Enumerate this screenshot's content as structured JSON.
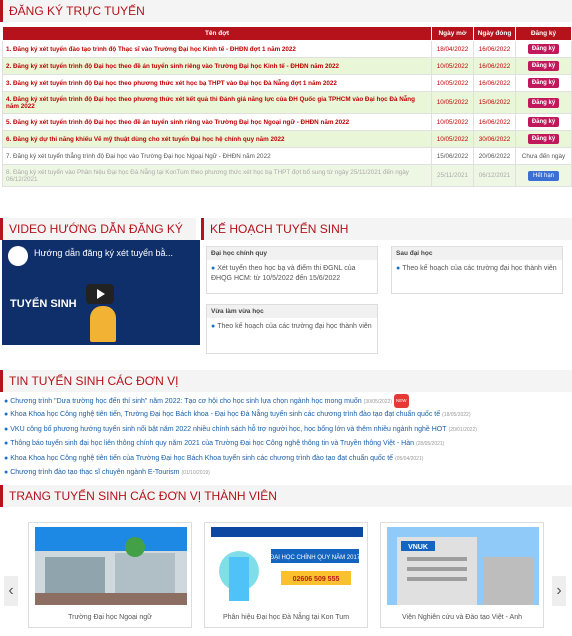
{
  "registration": {
    "title": "ĐĂNG KÝ TRỰC TUYẾN",
    "columns": [
      "Tên đợt",
      "Ngày mở",
      "Ngày đóng",
      "Đăng ký"
    ],
    "rows": [
      {
        "name": "1. Đăng ký xét tuyển đào tạo trình độ Thạc sĩ vào Trường Đại học Kinh tế - ĐHĐN đợt 1 năm 2022",
        "open": "18/04/2022",
        "close": "16/06/2022",
        "action": "Đăng ký",
        "state": "open"
      },
      {
        "name": "2. Đăng ký xét tuyển trình độ Đại học theo đề án tuyển sinh riêng vào Trường Đại học Kinh tế - ĐHĐN năm 2022",
        "open": "10/05/2022",
        "close": "16/06/2022",
        "action": "Đăng ký",
        "state": "open"
      },
      {
        "name": "3. Đăng ký xét tuyển trình độ Đại học theo phương thức xét học bạ THPT vào Đại học Đà Nẵng đợt 1 năm 2022",
        "open": "10/05/2022",
        "close": "16/06/2022",
        "action": "Đăng ký",
        "state": "open"
      },
      {
        "name": "4. Đăng ký xét tuyển trình độ Đại học theo phương thức xét kết quả thi Đánh giá năng lực của ĐH Quốc gia TPHCM vào Đại học Đà Nẵng năm 2022",
        "open": "10/05/2022",
        "close": "15/06/2022",
        "action": "Đăng ký",
        "state": "open"
      },
      {
        "name": "5. Đăng ký xét tuyển trình độ Đại học theo đề án tuyển sinh riêng vào Trường Đại học Ngoại ngữ - ĐHĐN năm 2022",
        "open": "10/05/2022",
        "close": "16/06/2022",
        "action": "Đăng ký",
        "state": "open"
      },
      {
        "name": "6. Đăng ký dự thi năng khiếu Vẽ mỹ thuật dùng cho xét tuyển Đại học hệ chính quy năm 2022",
        "open": "10/05/2022",
        "close": "30/06/2022",
        "action": "Đăng ký",
        "state": "open"
      },
      {
        "name": "7. Đăng ký xét tuyển thẳng trình độ Đại học vào Trường Đại học Ngoại Ngữ - ĐHĐN năm 2022",
        "open": "15/06/2022",
        "close": "20/06/2022",
        "action": "Chưa đến ngày",
        "state": "closed"
      },
      {
        "name": "8. Đăng ký xét tuyển vào Phân hiệu Đại học Đà Nẵng tại KonTum theo phương thức xét học bạ THPT đợt bổ sung từ ngày 25/11/2021 đến ngày 06/12/2021",
        "open": "25/11/2021",
        "close": "06/12/2021",
        "action": "Hết hạn",
        "state": "future"
      }
    ]
  },
  "video": {
    "title": "VIDEO HƯỚNG DẪN ĐĂNG KÝ",
    "caption": "Hướng dẫn đăng ký xét tuyển bằ...",
    "banner": "TUYỂN SINH"
  },
  "plan": {
    "title": "KẾ HOẠCH TUYỂN SINH",
    "boxes": [
      {
        "head": "Đại học chính quy",
        "body": "Xét tuyển theo học bạ và điểm thi ĐGNL của ĐHQG HCM: từ 10/5/2022 đến 15/6/2022"
      },
      {
        "head": "Sau đại học",
        "body": "Theo kế hoạch của các trường đại học thành viên"
      },
      {
        "head": "Vừa làm vừa học",
        "body": "Theo kế hoạch của các trường đại học thành viên"
      }
    ]
  },
  "news": {
    "title": "TIN TUYỂN SINH CÁC ĐƠN VỊ",
    "badge_new": "NEW",
    "items": [
      {
        "text": "Chương trình \"Dưa trường học đến thí sinh\" năm 2022: Tạo cơ hội cho học sinh lựa chọn ngành học mong muốn",
        "date": "(30/05/2022)",
        "new": true
      },
      {
        "text": "Khoa Khoa học Công nghệ tiên tiến, Trường Đại học Bách khoa - Đại học Đà Nẵng tuyển sinh các chương trình đào tạo đạt chuẩn quốc tế",
        "date": "(18/05/2022)",
        "new": false
      },
      {
        "text": "VKU công bố phương hướng tuyển sinh nổi bật năm 2022 nhiều chính sách hỗ trợ người học, học bổng lớn và thêm nhiều ngành nghề HOT",
        "date": "(20/01/2022)",
        "new": false
      },
      {
        "text": "Thông báo tuyển sinh đại học liên thông chính quy năm 2021 của Trường Đại học Công nghệ thông tin và Truyền thông Việt - Hàn",
        "date": "(28/05/2021)",
        "new": false
      },
      {
        "text": "Khoa Khoa học Công nghệ tiên tiến của Trường Đại học Bách Khoa tuyển sinh các chương trình đào tạo đạt chuẩn quốc tế",
        "date": "(05/04/2021)",
        "new": false
      },
      {
        "text": "Chương trình đào tạo thạc sĩ chuyên ngành E-Tourism",
        "date": "(01/10/2019)",
        "new": false
      }
    ]
  },
  "units": {
    "title": "TRANG TUYỂN SINH CÁC ĐƠN VỊ THÀNH VIÊN",
    "cards": [
      {
        "caption": "Trường Đại học Ngoại ngữ"
      },
      {
        "caption": "Phân hiệu Đại học Đà Nẵng tại Kon Tum",
        "banner": "ĐẠI HỌC CHÍNH QUY NĂM 2017",
        "phone": "02606 509 555"
      },
      {
        "caption": "Viện Nghiên cứu và Đào tạo Việt - Anh",
        "logo": "VNUK"
      }
    ],
    "prev": "‹",
    "next": "›"
  }
}
